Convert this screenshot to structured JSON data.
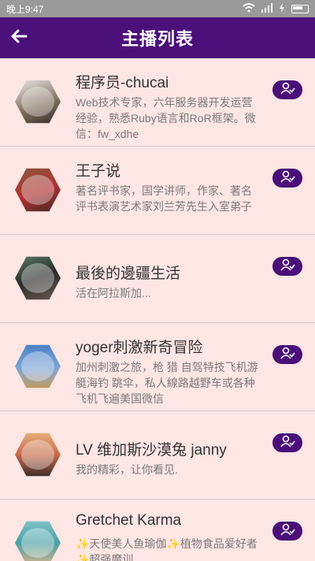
{
  "status": {
    "time_label": "晚上9:47"
  },
  "header": {
    "title": "主播列表"
  },
  "anchors": [
    {
      "name": "程序员-chucai",
      "desc": "Web技术专家，六年服务器开发运营经验，熟悉Ruby语言和RoR框架。微信：fw_xdhe"
    },
    {
      "name": "王子说",
      "desc": "著名评书家，国学讲师，作家、著名评书表演艺术家刘兰芳先生入室弟子"
    },
    {
      "name": "最後的邊疆生活",
      "desc": "活在阿拉斯加..."
    },
    {
      "name": "yoger刺激新奇冒险",
      "desc": "加州刺激之旅，枪 猎 自驾特技飞机游艇海钓 跳伞，私人線路越野车或各种飞机飞遍美国微信"
    },
    {
      "name": "LV 维加斯沙漠兔 janny",
      "desc": "我的精彩，让你看见."
    },
    {
      "name": "Gretchet Karma",
      "desc": "✨天使美人鱼瑜伽✨植物食品爱好者✨超强魔训"
    }
  ],
  "colors": {
    "appbar": "#4b0f7a",
    "background": "#fde6e4",
    "follow_button": "#4b0f7a"
  }
}
